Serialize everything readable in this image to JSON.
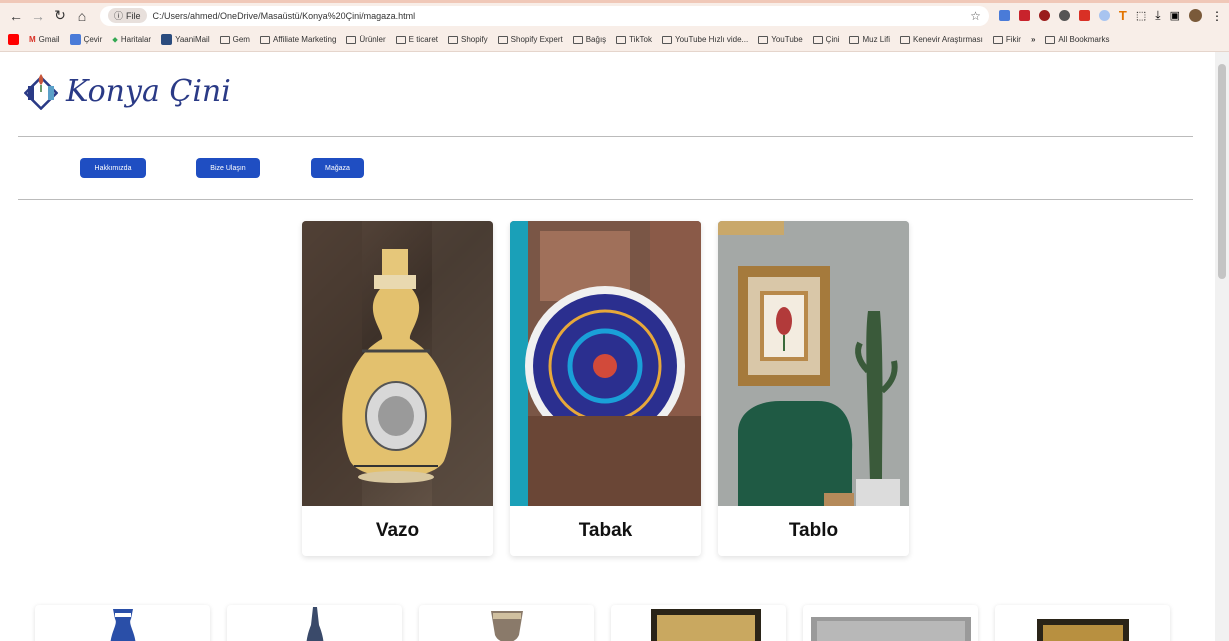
{
  "browser": {
    "file_chip": "File",
    "url": "C:/Users/ahmed/OneDrive/Masaüstü/Konya%20Çini/magaza.html",
    "bookmarks": [
      "Gmail",
      "Çevir",
      "Haritalar",
      "YaaniMail",
      "Gem",
      "Affiliate Marketing",
      "Ürünler",
      "E ticaret",
      "Shopify",
      "Shopify Expert",
      "Bağış",
      "TikTok",
      "YouTube Hızlı vide...",
      "YouTube",
      "Çini",
      "Muz Lifi",
      "Kenevir Araştırması",
      "Fikir"
    ],
    "overflow_label": "»",
    "all_bookmarks": "All Bookmarks"
  },
  "logo": {
    "text": "Konya Çini"
  },
  "menu": {
    "items": [
      "Hakkımızda",
      "Bize Ulaşın",
      "Mağaza"
    ]
  },
  "products": [
    {
      "title": "Vazo"
    },
    {
      "title": "Tabak"
    },
    {
      "title": "Tablo"
    }
  ],
  "colors": {
    "accent": "#1f4ec2",
    "logo": "#2a3a86"
  }
}
